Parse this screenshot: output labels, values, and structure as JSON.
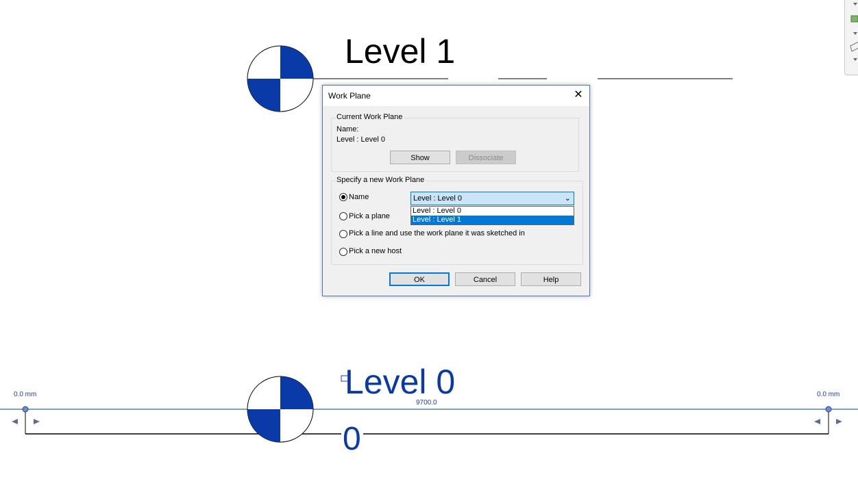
{
  "canvas": {
    "level1_label": "Level 1",
    "level0_label": "Level 0",
    "level0_secondary": "0",
    "offset_left": "0.0 mm",
    "offset_right": "0.0 mm",
    "dimension_value": "9700.0"
  },
  "dialog": {
    "title": "Work Plane",
    "current_group": {
      "legend": "Current Work Plane",
      "name_label": "Name:",
      "name_value": "Level : Level 0",
      "show_button": "Show",
      "dissociate_button": "Dissociate"
    },
    "new_group": {
      "legend": "Specify a new Work Plane",
      "options": [
        {
          "label": "Name",
          "checked": true
        },
        {
          "label": "Pick a plane",
          "checked": false
        },
        {
          "label": "Pick a line and use the work plane it was sketched in",
          "checked": false
        },
        {
          "label": "Pick a new host",
          "checked": false
        }
      ],
      "select_value": "Level : Level 0",
      "dropdown_items": [
        {
          "label": "Level : Level 0",
          "highlighted": false
        },
        {
          "label": "Level : Level 1",
          "highlighted": true
        }
      ]
    },
    "buttons": {
      "ok": "OK",
      "cancel": "Cancel",
      "help": "Help"
    }
  },
  "colors": {
    "level_blue": "#0a3aa8",
    "accent": "#0078d7"
  }
}
